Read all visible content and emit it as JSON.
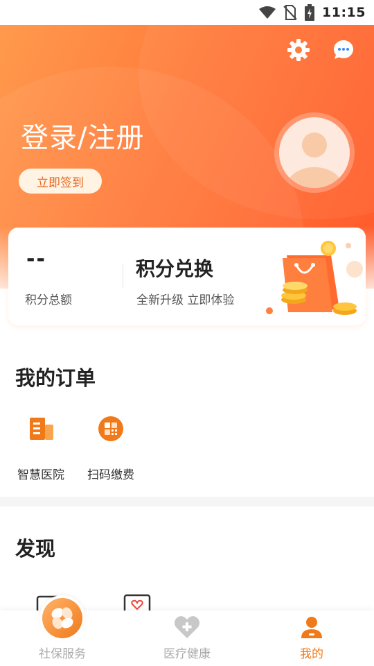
{
  "status_bar": {
    "time": "11:15"
  },
  "header": {
    "login_label": "登录/注册",
    "checkin_label": "立即签到",
    "settings_icon": "gear-icon",
    "message_icon": "chat-bubble-icon"
  },
  "points_card": {
    "points_value": "--",
    "points_label": "积分总额",
    "exchange_title": "积分兑换",
    "exchange_subtitle": "全新升级 立即体验"
  },
  "orders": {
    "title": "我的订单",
    "items": [
      {
        "label": "智慧医院",
        "icon": "hospital-icon"
      },
      {
        "label": "扫码缴费",
        "icon": "scan-pay-icon"
      }
    ]
  },
  "discover": {
    "title": "发现"
  },
  "tabs": [
    {
      "label": "社保服务",
      "icon": "social-security-icon",
      "active": false
    },
    {
      "label": "医疗健康",
      "icon": "heart-plus-icon",
      "active": false
    },
    {
      "label": "我的",
      "icon": "person-icon",
      "active": true
    }
  ],
  "colors": {
    "accent": "#f07a1a",
    "hero_start": "#ff9a4d",
    "hero_end": "#ff5a2a"
  }
}
